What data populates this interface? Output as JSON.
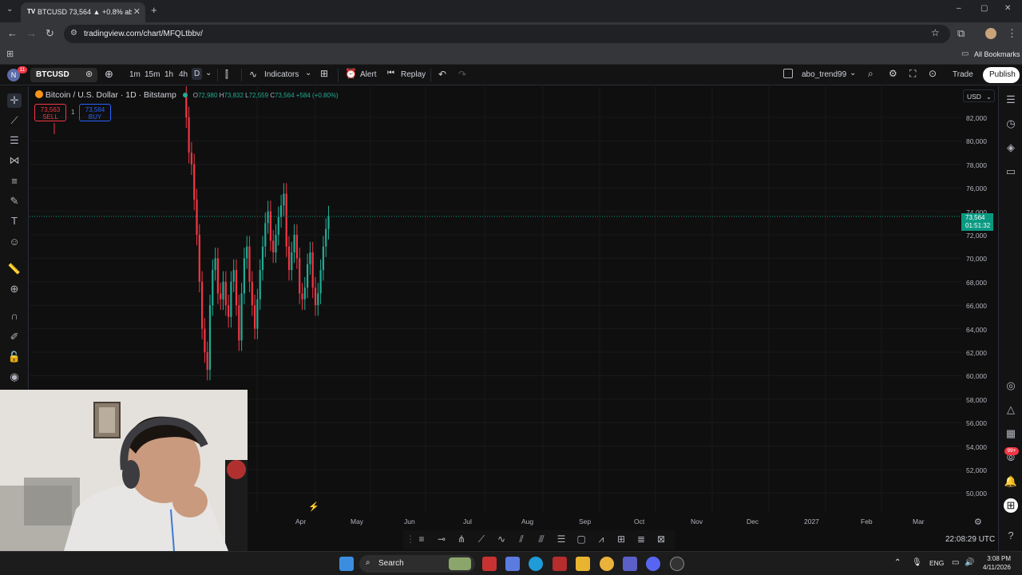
{
  "browser": {
    "tab_title": "BTCUSD 73,564 ▲ +0.8% abo_t",
    "tab_favicon": "TV",
    "url": "tradingview.com/chart/MFQLtbbv/",
    "all_bookmarks": "All Bookmarks"
  },
  "toolbar": {
    "avatar_letter": "N",
    "avatar_badge": "11",
    "symbol": "BTCUSD",
    "intervals": [
      "1m",
      "15m",
      "1h",
      "4h",
      "D"
    ],
    "indicators": "Indicators",
    "alert": "Alert",
    "replay": "Replay",
    "layout_name": "abo_trend99",
    "trade": "Trade",
    "publish": "Publish"
  },
  "legend": {
    "title": "Bitcoin / U.S. Dollar · 1D · Bitstamp",
    "o_label": "O",
    "o": "72,980",
    "h_label": "H",
    "h": "73,832",
    "l_label": "L",
    "l": "72,559",
    "c_label": "C",
    "c": "73,564",
    "change": "+584 (+0.80%)",
    "sell_price": "73,563",
    "sell": "SELL",
    "spread": "1",
    "buy_price": "73,564",
    "buy": "BUY"
  },
  "price_axis": {
    "currency": "USD",
    "labels": [
      "82,000",
      "80,000",
      "78,000",
      "76,000",
      "74,000",
      "72,000",
      "70,000",
      "68,000",
      "66,000",
      "64,000",
      "62,000",
      "60,000",
      "58,000",
      "56,000",
      "54,000",
      "52,000",
      "50,000"
    ],
    "current_price": "73,564",
    "countdown": "01:51:32"
  },
  "time_axis": {
    "labels": [
      "Apr",
      "May",
      "Jun",
      "Jul",
      "Aug",
      "Sep",
      "Oct",
      "Nov",
      "Dec",
      "2027",
      "Feb",
      "Mar"
    ]
  },
  "chart_data": {
    "type": "candlestick",
    "series": [
      {
        "name": "BTCUSD",
        "last_close": 73564
      }
    ],
    "ylim": [
      49000,
      83500
    ],
    "x_ticks": [
      "Apr",
      "May",
      "Jun",
      "Jul",
      "Aug",
      "Sep",
      "Oct",
      "Nov",
      "Dec",
      "2027",
      "Feb",
      "Mar"
    ],
    "candles_close": [
      84000,
      82000,
      79000,
      78000,
      75000,
      72000,
      68000,
      64000,
      62000,
      60500,
      66000,
      69000,
      70000,
      67000,
      66500,
      68000,
      66000,
      65000,
      68000,
      69000,
      66000,
      63000,
      67000,
      70000,
      71000,
      68000,
      66000,
      64000,
      66500,
      69000,
      71000,
      73000,
      74000,
      71500,
      70500,
      72000,
      73500,
      74500,
      75500,
      71000,
      69000,
      70500,
      72000,
      70000,
      67000,
      66500,
      67500,
      69500,
      70500,
      67500,
      66000,
      67000,
      69000,
      71000,
      72500,
      73564
    ],
    "current_price": 73564,
    "colors": {
      "up": "#22ab94",
      "down": "#f23645"
    }
  },
  "status": {
    "clock": "22:08:29 UTC",
    "taskbar_search": "Search",
    "lang": "ENG",
    "time": "3:08 PM",
    "date": "4/11/2026",
    "badge": "99+"
  }
}
